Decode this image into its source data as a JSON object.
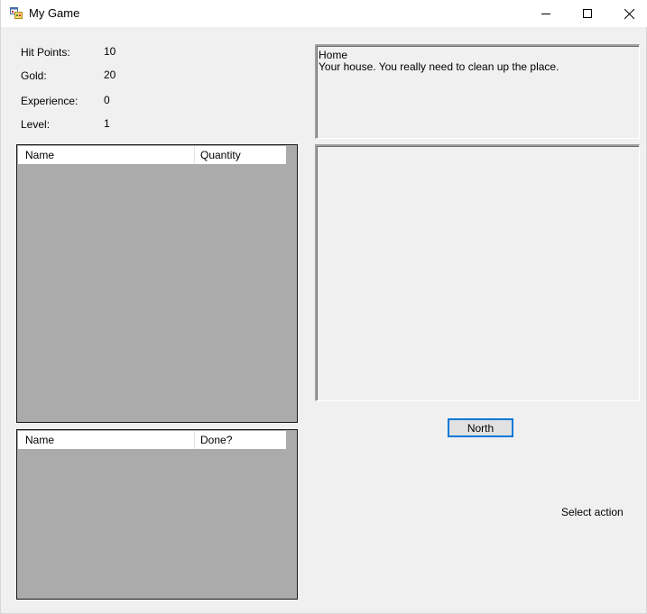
{
  "window": {
    "title": "My Game",
    "icon": "winforms-app-icon",
    "controls": {
      "minimize_icon": "minimize-icon",
      "maximize_icon": "maximize-icon",
      "close_icon": "close-icon"
    }
  },
  "stats": {
    "hit_points_label": "Hit Points:",
    "hit_points_value": "10",
    "gold_label": "Gold:",
    "gold_value": "20",
    "experience_label": "Experience:",
    "experience_value": "0",
    "level_label": "Level:",
    "level_value": "1"
  },
  "inventory": {
    "columns": [
      "Name",
      "Quantity"
    ],
    "rows": []
  },
  "quests": {
    "columns": [
      "Name",
      "Done?"
    ],
    "rows": []
  },
  "location": {
    "name": "Home",
    "description": "Your house. You really need to clean up the place."
  },
  "messages": {
    "text": ""
  },
  "actions": {
    "north_label": "North",
    "select_action_label": "Select action"
  },
  "colors": {
    "window_bg": "#f0f0f0",
    "listview_bg": "#ababab",
    "button_focus_border": "#0078d7"
  }
}
